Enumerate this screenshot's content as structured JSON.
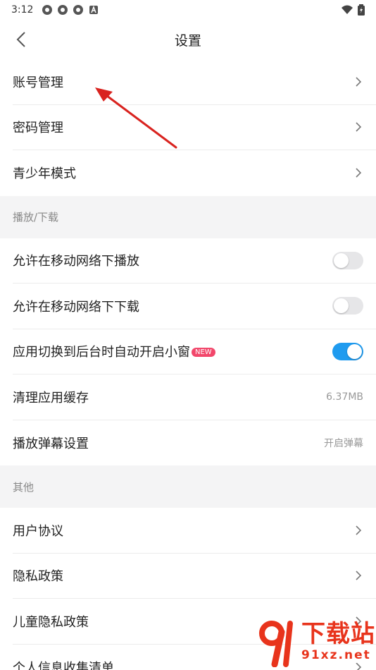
{
  "status_bar": {
    "time": "3:12"
  },
  "header": {
    "title": "设置"
  },
  "account_group": [
    {
      "label": "账号管理"
    },
    {
      "label": "密码管理"
    },
    {
      "label": "青少年模式"
    }
  ],
  "playback_section": {
    "title": "播放/下载",
    "mobile_play": {
      "label": "允许在移动网络下播放",
      "on": false
    },
    "mobile_download": {
      "label": "允许在移动网络下下载",
      "on": false
    },
    "background_pip": {
      "label": "应用切换到后台时自动开启小窗",
      "badge": "NEW",
      "on": true
    },
    "clear_cache": {
      "label": "清理应用缓存",
      "value": "6.37MB"
    },
    "danmaku": {
      "label": "播放弹幕设置",
      "value": "开启弹幕"
    }
  },
  "other_section": {
    "title": "其他",
    "items": [
      {
        "label": "用户协议"
      },
      {
        "label": "隐私政策"
      },
      {
        "label": "儿童隐私政策"
      },
      {
        "label": "个人信息收集清单"
      }
    ]
  },
  "watermark": {
    "logo": "91",
    "main": "下载站",
    "sub": "91xz.net"
  },
  "colors": {
    "accent": "#1f9bef",
    "badge": "#f2476b",
    "annotation_arrow": "#d9231f"
  }
}
